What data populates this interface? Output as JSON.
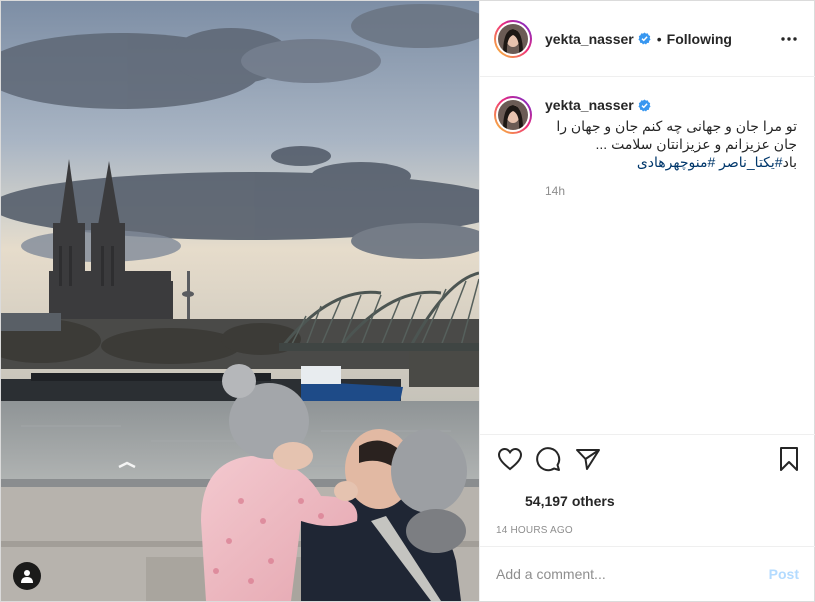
{
  "post": {
    "username": "yekta_nasser",
    "follow_state": "Following",
    "separator": "•"
  },
  "caption": {
    "username": "yekta_nasser",
    "line1": "تو مرا جان و جهانی چه کنم جان و جهان را",
    "line2": "جان عزیزانم و عزیزانتان سلامت ...",
    "line3_text": "باد",
    "hashtag1": "#یکتا_ناصر",
    "hashtag2": "#منوچهرهادی",
    "time": "14h"
  },
  "stats": {
    "likes_count": "54,197",
    "likes_word": "others",
    "age": "14 HOURS AGO"
  },
  "comment_box": {
    "placeholder": "Add a comment...",
    "post_label": "Post"
  },
  "icons": {
    "verified": "verified-badge-icon",
    "more": "more-options-icon",
    "like": "heart-icon",
    "comment": "comment-bubble-icon",
    "share": "paper-plane-icon",
    "save": "bookmark-icon",
    "user_tag": "user-tag-icon"
  },
  "colors": {
    "verified_blue": "#3897f0",
    "hashtag": "#00376b",
    "post_disabled": "#b3dbff",
    "muted": "#8e8e8e",
    "text": "#262626"
  }
}
